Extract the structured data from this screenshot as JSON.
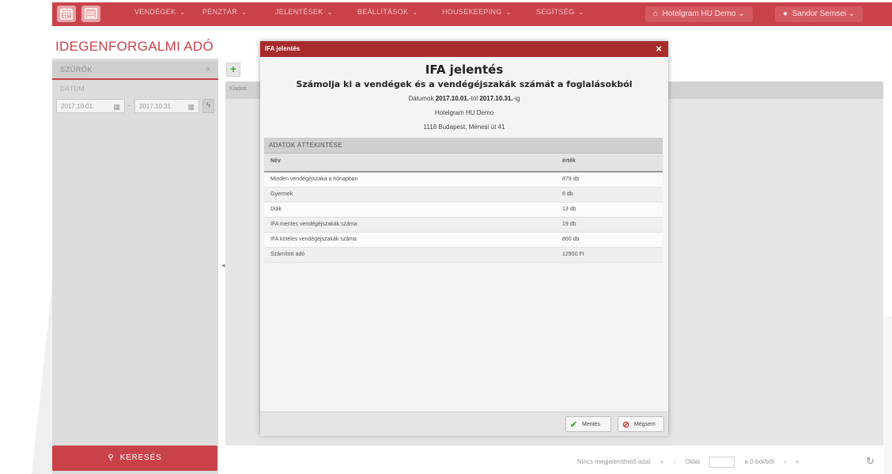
{
  "nav": {
    "items": [
      {
        "label": "VENDÉGEK",
        "chev": "⌄"
      },
      {
        "label": "PÉNZTÁR",
        "chev": "⌄"
      },
      {
        "label": "JELENTÉSEK",
        "chev": "⌄"
      },
      {
        "label": "BEÁLLÍTÁSOK",
        "chev": "⌄"
      },
      {
        "label": "HOUSEKEEPING",
        "chev": "⌄"
      },
      {
        "label": "SEGÍTSÉG",
        "chev": "⌄"
      }
    ],
    "hotel": "Hotelgram HU Demo",
    "user": "Sandor Semsei",
    "chev": "⌄"
  },
  "page": {
    "title": "IDEGENFORGALMI ADÓ"
  },
  "sidebar": {
    "filters_label": "SZŰRŐK",
    "collapse_glyph": "«",
    "date_label": "DÁTUM",
    "date_from": "2017.10.01.",
    "date_to": "2017.10.31.",
    "date_sep": "-",
    "search_label": "KERESÉS"
  },
  "main": {
    "add_glyph": "+",
    "first_column": "Kiadott",
    "pager": {
      "no_data": "Nincs megjeleníthető adat",
      "first": "«",
      "prev": "‹",
      "page_label": "Oldal",
      "of_label": "a 0-ból/ből",
      "next": "›",
      "last": "»"
    },
    "refresh_glyph": "↻"
  },
  "modal": {
    "bar_title": "IFA jelentés",
    "close_glyph": "×",
    "title": "IFA jelentés",
    "subtitle": "Számolja ki a vendégek és a vendégéjszakák számát a foglalásokból",
    "date_prefix": "Dátumok",
    "date_from": "2017.10.01.",
    "date_mid": "-tól",
    "date_to": "2017.10.31.",
    "date_suffix": "-ig",
    "hotel": "Hotelgram HU Demo",
    "address": "1118 Budapest, Ménesi út 41",
    "panel_title": "ADATOK ÁTTEKINTÉSE",
    "col_name": "Név",
    "col_value": "érték",
    "rows": [
      {
        "name": "Minden vendégéjszaka a hónapban",
        "value": "879 db"
      },
      {
        "name": "Gyermek",
        "value": "6 db"
      },
      {
        "name": "Diák",
        "value": "13 db"
      },
      {
        "name": "IFA mentes vendégéjszakák száma",
        "value": "19 db"
      },
      {
        "name": "IFA köteles vendégéjszakák száma",
        "value": "860 db"
      },
      {
        "name": "Számított adó",
        "value": "12900 Ft"
      }
    ],
    "save_label": "Mentés",
    "cancel_label": "Mégsem"
  },
  "colors": {
    "brand": "#c9424a",
    "modal_bar": "#a82c2c",
    "save_icon": "#3fae3f",
    "cancel_icon": "#d23232"
  }
}
